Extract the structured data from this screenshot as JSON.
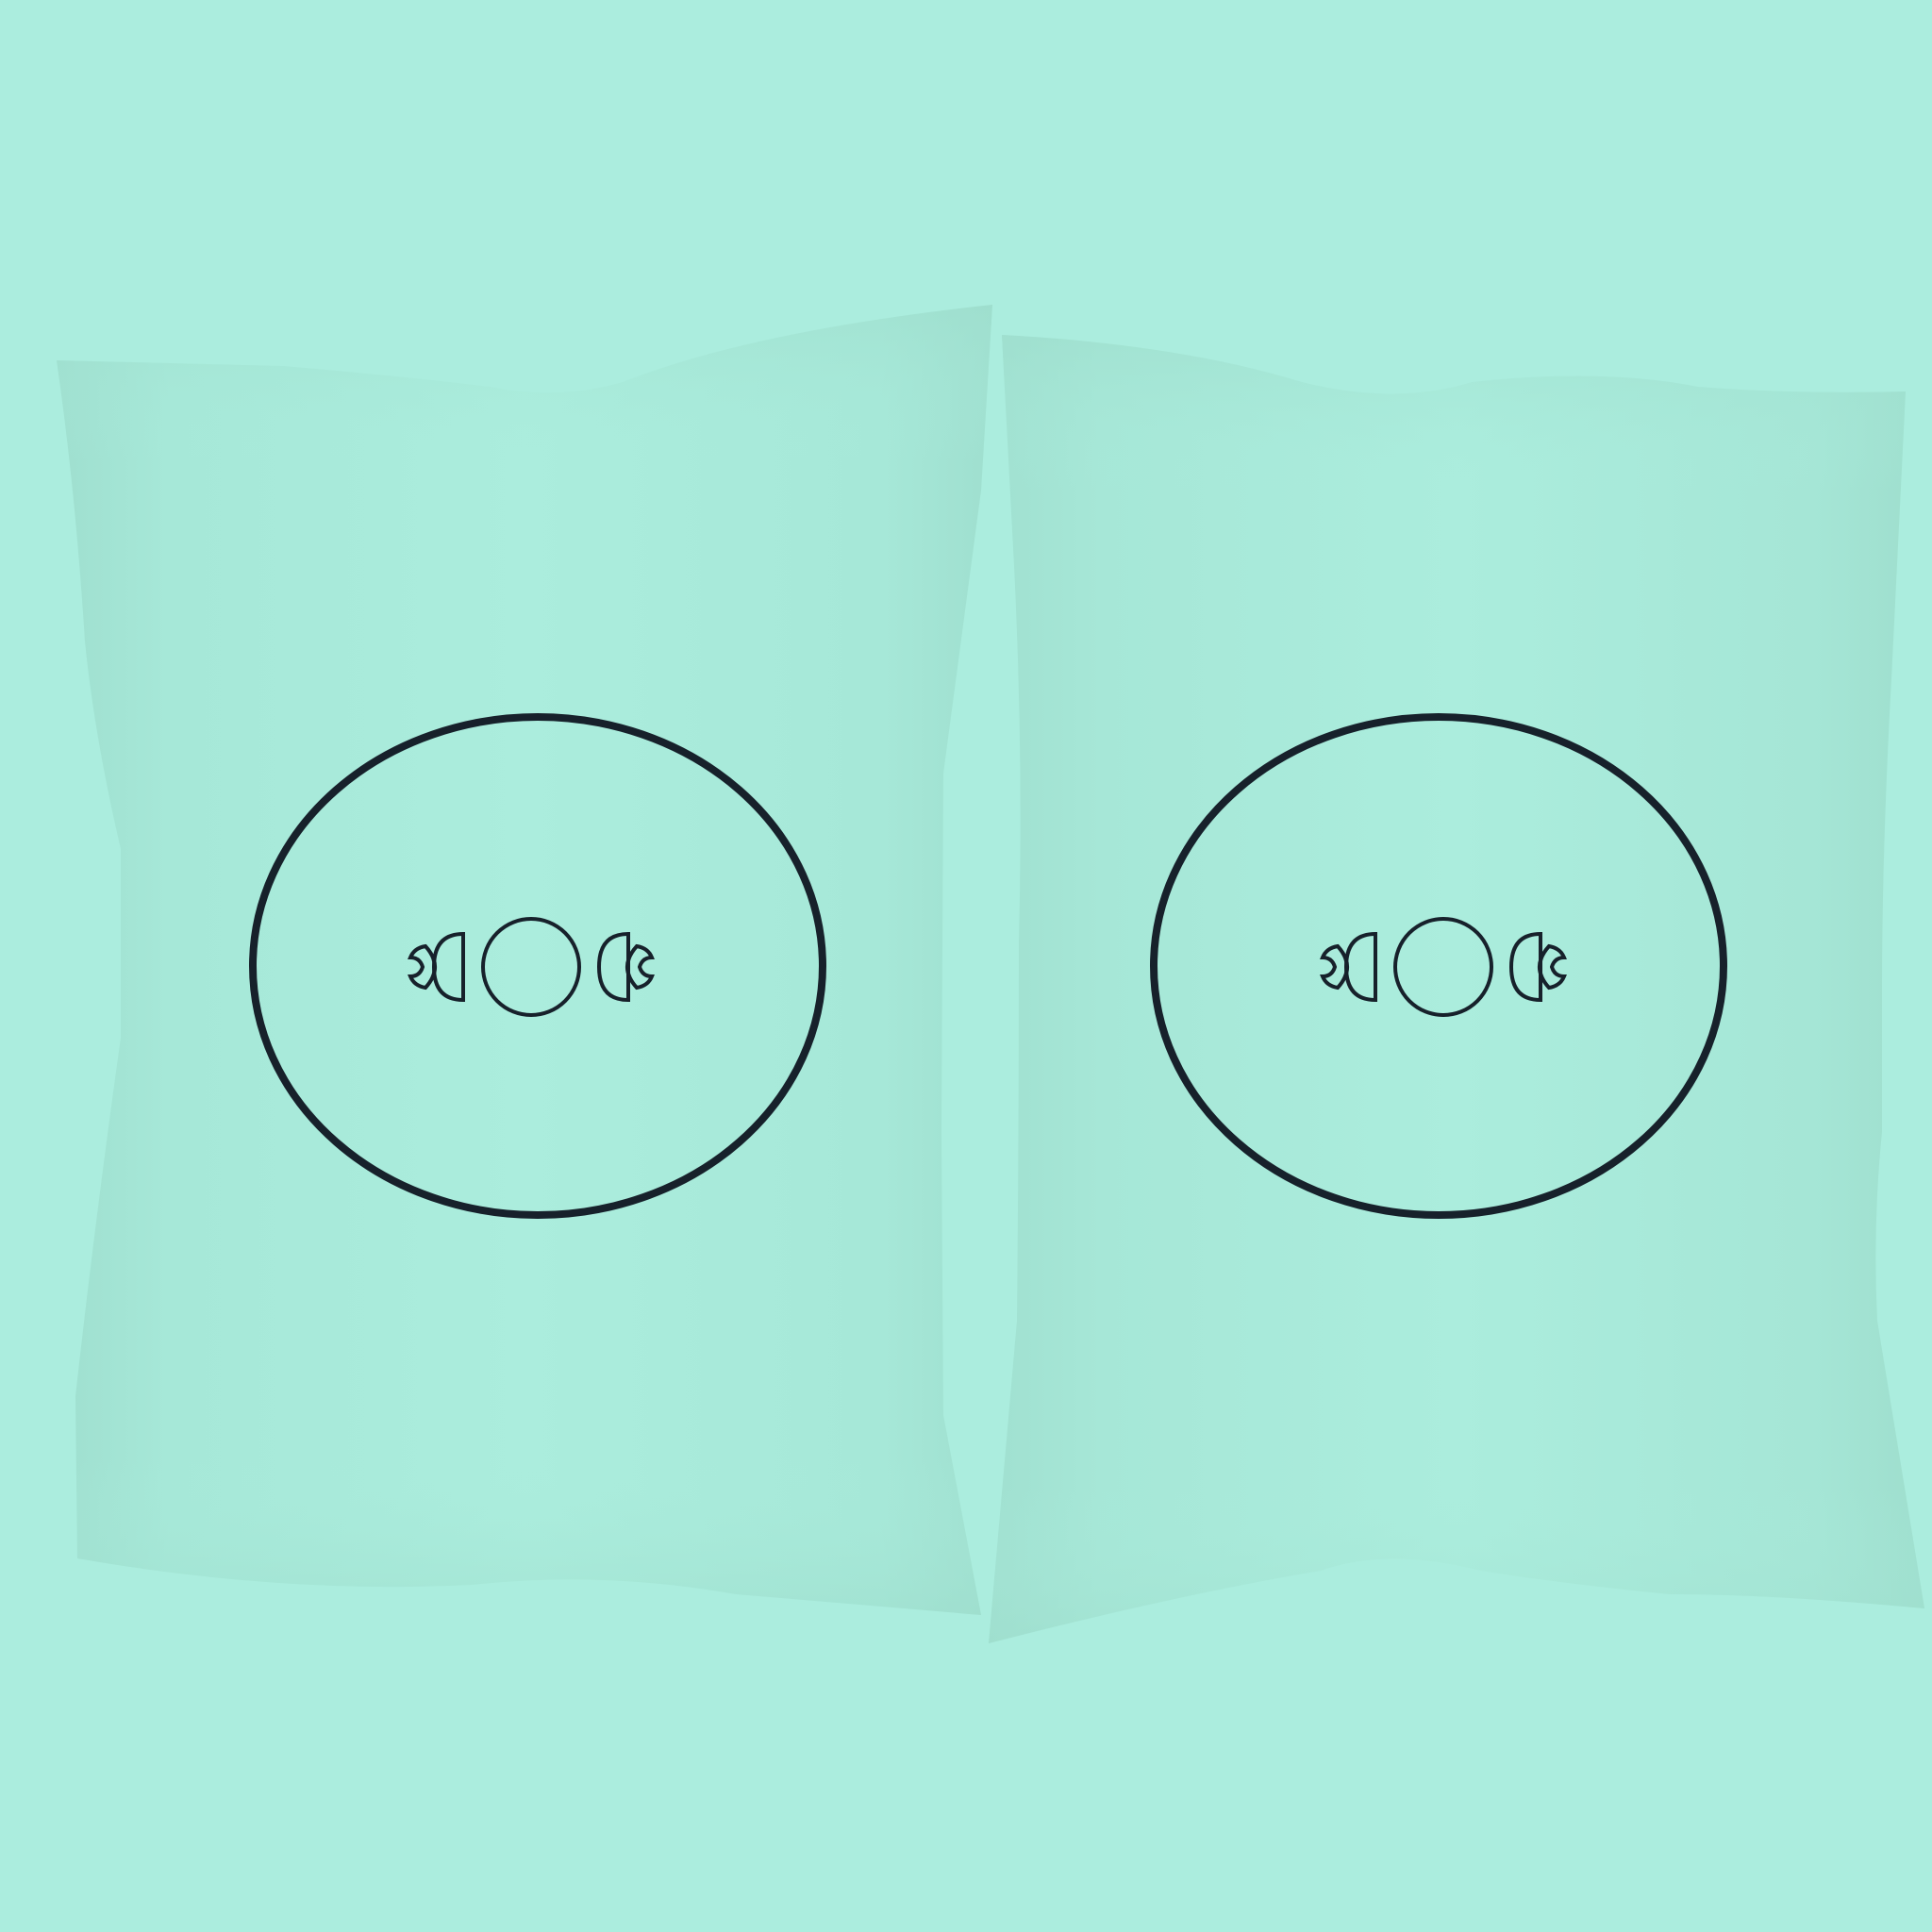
{
  "scene": {
    "description_items": [
      {
        "kind": "pillowcase",
        "motif": "triple-moon-symbol",
        "side": "left"
      },
      {
        "kind": "pillowcase",
        "motif": "triple-moon-symbol",
        "side": "right"
      }
    ]
  },
  "colors": {
    "background": "#abedde",
    "fabric": "#a9ebdb",
    "fabric_shadow": "#9fdfcf",
    "fabric_highlight": "#b4f2e3",
    "ink": "#17212b"
  },
  "icons": {
    "left_motif": "triple-moon-icon",
    "right_motif": "triple-moon-icon"
  }
}
